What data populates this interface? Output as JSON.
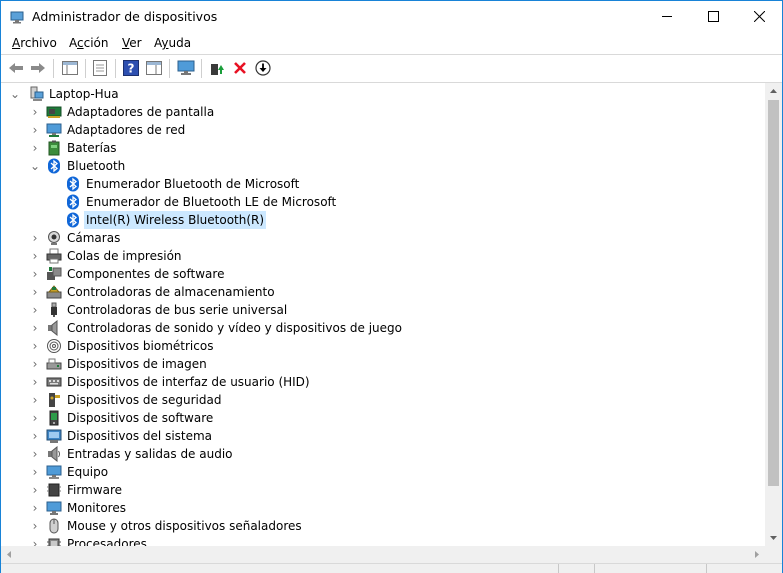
{
  "window": {
    "title": "Administrador de dispositivos",
    "accent": "#1883d7"
  },
  "menu": [
    {
      "label": "Archivo",
      "accel": "A",
      "rest": "rchivo"
    },
    {
      "label": "Acción",
      "accel": "c",
      "first": "A",
      "rest": "ción"
    },
    {
      "label": "Ver",
      "accel": "V",
      "rest": "er"
    },
    {
      "label": "Ayuda",
      "accel": "y",
      "first": "A",
      "rest": "uda"
    }
  ],
  "toolbar": {
    "icons": [
      "back-arrow-icon",
      "forward-arrow-icon",
      "show-hide-console-tree-icon",
      "properties-icon",
      "help-icon",
      "action-pane-icon",
      "monitor-icon",
      "update-driver-icon",
      "uninstall-x-icon",
      "download-arrow-icon"
    ],
    "uninstall_color": "#e81123"
  },
  "tree": {
    "root": "Laptop-Hua",
    "selected_color": "#cce8ff",
    "categories": [
      {
        "label": "Adaptadores de pantalla",
        "icon": "display-adapter-icon"
      },
      {
        "label": "Adaptadores de red",
        "icon": "network-adapter-icon"
      },
      {
        "label": "Baterías",
        "icon": "battery-icon"
      },
      {
        "label": "Bluetooth",
        "icon": "bluetooth-icon",
        "expanded": true,
        "children": [
          {
            "label": "Enumerador Bluetooth de Microsoft",
            "icon": "bluetooth-icon"
          },
          {
            "label": "Enumerador de Bluetooth LE de Microsoft",
            "icon": "bluetooth-icon"
          },
          {
            "label": "Intel(R) Wireless Bluetooth(R)",
            "icon": "bluetooth-icon",
            "selected": true
          }
        ]
      },
      {
        "label": "Cámaras",
        "icon": "camera-icon"
      },
      {
        "label": "Colas de impresión",
        "icon": "printer-icon"
      },
      {
        "label": "Componentes de software",
        "icon": "software-component-icon"
      },
      {
        "label": "Controladoras de almacenamiento",
        "icon": "storage-controller-icon"
      },
      {
        "label": "Controladoras de bus serie universal",
        "icon": "usb-icon"
      },
      {
        "label": "Controladoras de sonido y vídeo y dispositivos de juego",
        "icon": "speaker-icon"
      },
      {
        "label": "Dispositivos biométricos",
        "icon": "fingerprint-icon"
      },
      {
        "label": "Dispositivos de imagen",
        "icon": "scanner-icon"
      },
      {
        "label": "Dispositivos de interfaz de usuario (HID)",
        "icon": "keyboard-hid-icon"
      },
      {
        "label": "Dispositivos de seguridad",
        "icon": "security-key-icon"
      },
      {
        "label": "Dispositivos de software",
        "icon": "software-device-icon"
      },
      {
        "label": "Dispositivos del sistema",
        "icon": "system-device-icon"
      },
      {
        "label": "Entradas y salidas de audio",
        "icon": "audio-io-icon"
      },
      {
        "label": "Equipo",
        "icon": "computer-icon"
      },
      {
        "label": "Firmware",
        "icon": "firmware-chip-icon"
      },
      {
        "label": "Monitores",
        "icon": "monitor-icon"
      },
      {
        "label": "Mouse y otros dispositivos señaladores",
        "icon": "mouse-icon"
      },
      {
        "label": "Procesadores",
        "icon": "processor-icon"
      }
    ]
  }
}
